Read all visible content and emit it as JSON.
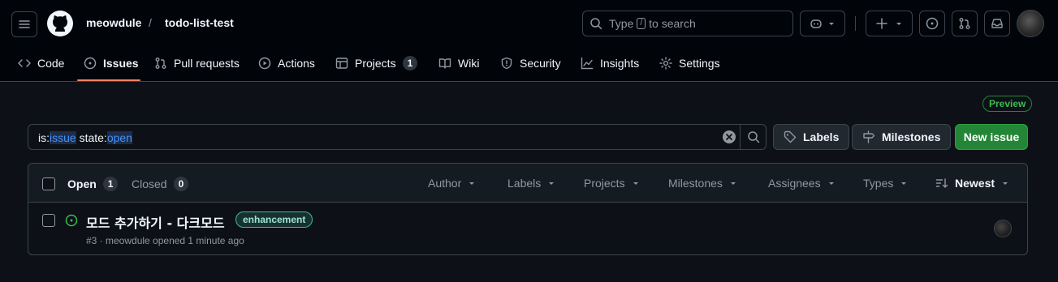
{
  "header": {
    "owner": "meowdule",
    "separator": "/",
    "repo": "todo-list-test",
    "search": {
      "prefix": "Type",
      "key": "/",
      "suffix": "to search"
    }
  },
  "tabs": [
    {
      "label": "Code",
      "icon": "code-icon"
    },
    {
      "label": "Issues",
      "icon": "issue-opened-icon",
      "active": true
    },
    {
      "label": "Pull requests",
      "icon": "git-pull-request-icon"
    },
    {
      "label": "Actions",
      "icon": "play-icon"
    },
    {
      "label": "Projects",
      "icon": "table-icon",
      "count": "1"
    },
    {
      "label": "Wiki",
      "icon": "book-icon"
    },
    {
      "label": "Security",
      "icon": "shield-icon"
    },
    {
      "label": "Insights",
      "icon": "graph-icon"
    },
    {
      "label": "Settings",
      "icon": "gear-icon"
    }
  ],
  "preview_badge": "Preview",
  "filter": {
    "part1": "is:",
    "part2": "issue",
    "part3": " state:",
    "part4": "open"
  },
  "buttons": {
    "labels": "Labels",
    "milestones": "Milestones",
    "new_issue": "New issue"
  },
  "list": {
    "open_label": "Open",
    "open_count": "1",
    "closed_label": "Closed",
    "closed_count": "0",
    "filters": [
      "Author",
      "Labels",
      "Projects",
      "Milestones",
      "Assignees",
      "Types"
    ],
    "sort": "Newest"
  },
  "issues": [
    {
      "title": "모드 추가하기 - 다크모드",
      "label": "enhancement",
      "meta": "#3 · meowdule opened 1 minute ago"
    }
  ],
  "colors": {
    "accent_green": "#238636",
    "open_icon": "#3fb950",
    "tab_underline": "#f78166",
    "link_blue": "#4493f8"
  }
}
